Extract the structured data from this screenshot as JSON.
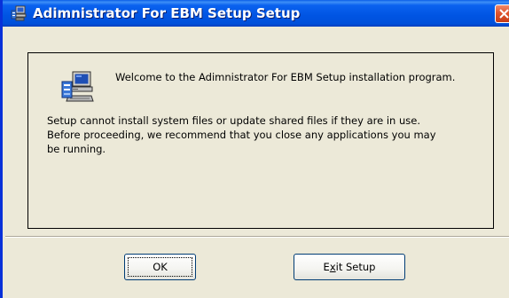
{
  "window": {
    "title": "Adimnistrator For EBM Setup Setup"
  },
  "dialog": {
    "welcome": "Welcome to the Adimnistrator For EBM Setup installation program.",
    "body_lines": [
      "Setup cannot install system files or update shared files if they are in use.",
      "Before proceeding, we recommend that you close any applications you may",
      "be running."
    ]
  },
  "buttons": {
    "ok_label": "OK",
    "exit_label_pre": "E",
    "exit_label_mnemonic": "x",
    "exit_label_post": "it Setup"
  },
  "icons": {
    "title": "setup-computer-icon",
    "close": "close-icon",
    "panel": "setup-computer-icon"
  },
  "colors": {
    "titlebar": "#0054e3",
    "window_bg": "#ece9d8",
    "close_button": "#e0542d"
  }
}
